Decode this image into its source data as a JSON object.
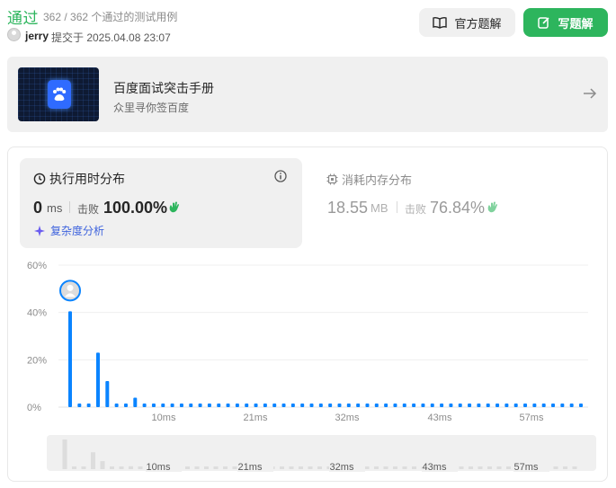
{
  "header": {
    "status": "通过",
    "cases": "362 / 362 个通过的测试用例",
    "username": "jerry",
    "submitted": "提交于 2025.04.08 23:07",
    "official_btn": "官方题解",
    "write_btn": "写题解"
  },
  "banner": {
    "title": "百度面试突击手册",
    "subtitle": "众里寻你签百度"
  },
  "runtime": {
    "title": "执行用时分布",
    "value": "0",
    "unit": "ms",
    "beat_label": "击败",
    "beat_pct": "100.00%",
    "complexity": "复杂度分析"
  },
  "memory": {
    "title": "消耗内存分布",
    "value": "18.55",
    "unit": "MB",
    "beat_label": "击败",
    "beat_pct": "76.84%"
  },
  "colors": {
    "accent_green": "#2db55d",
    "bar_blue": "#0a84ff",
    "link_blue": "#3e63dd"
  },
  "chart_data": {
    "type": "bar",
    "ytick_labels": [
      "60%",
      "40%",
      "20%",
      "0%"
    ],
    "ylim": [
      0,
      60
    ],
    "xtick_labels": [
      "10ms",
      "21ms",
      "32ms",
      "43ms",
      "57ms"
    ],
    "values": [
      40.5,
      1.5,
      1.5,
      23,
      11,
      1.5,
      1.5,
      4,
      1.5,
      1.5,
      1.5,
      1.5,
      1.5,
      1.5,
      1.5,
      1.5,
      1.5,
      1.5,
      1.5,
      1.5,
      1.5,
      1.5,
      1.5,
      1.5,
      1.5,
      1.5,
      1.5,
      1.5,
      1.5,
      1.5,
      1.5,
      1.5,
      1.5,
      1.5,
      1.5,
      1.5,
      1.5,
      1.5,
      1.5,
      1.5,
      1.5,
      1.5,
      1.5,
      1.5,
      1.5,
      1.5,
      1.5,
      1.5,
      1.5,
      1.5,
      1.5,
      1.5,
      1.5,
      1.5,
      1.5,
      1.5
    ],
    "highlight_index": 0
  },
  "mini_chart": {
    "xtick_labels": [
      "10ms",
      "21ms",
      "32ms",
      "43ms",
      "57ms"
    ]
  }
}
